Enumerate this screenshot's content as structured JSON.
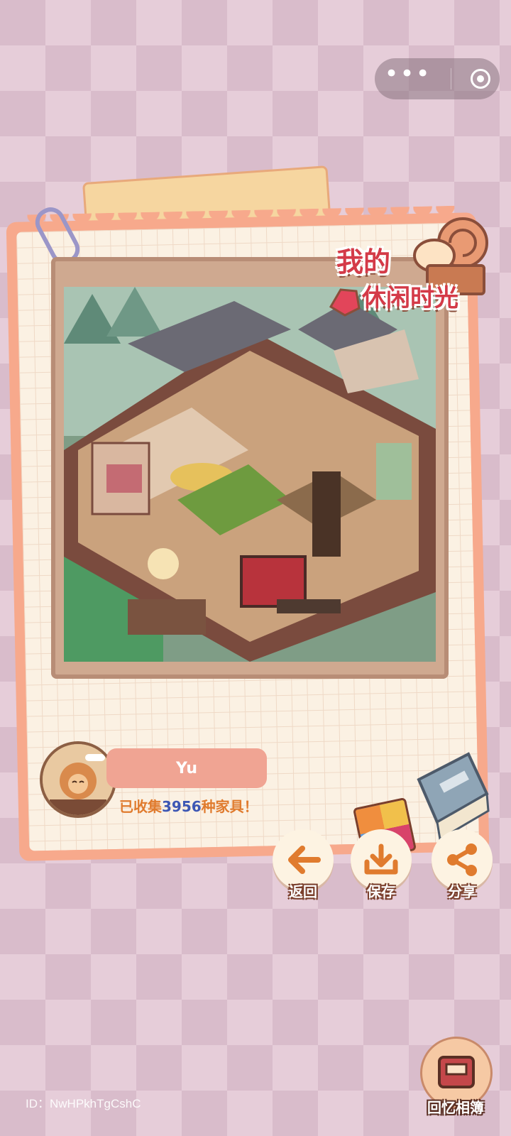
{
  "mini_program_capsule": {
    "more_icon": "more-dots-icon",
    "close_icon": "target-close-icon"
  },
  "logo": {
    "line1": "我的",
    "line2": "休闲时光"
  },
  "profile": {
    "name": "Yu",
    "collected_prefix": "已收集",
    "collected_count": "3956",
    "collected_suffix": "种家具！"
  },
  "actions": [
    {
      "label": "返回",
      "icon": "arrow-left-icon"
    },
    {
      "label": "保存",
      "icon": "download-icon"
    },
    {
      "label": "分享",
      "icon": "share-icon"
    }
  ],
  "album": {
    "label": "回忆相簿"
  },
  "footer": {
    "id_text": "ID：NwHPkhTgCshC"
  },
  "colors": {
    "accent": "#e07b2e",
    "pill": "#f0a493",
    "count": "#3d57b4"
  }
}
